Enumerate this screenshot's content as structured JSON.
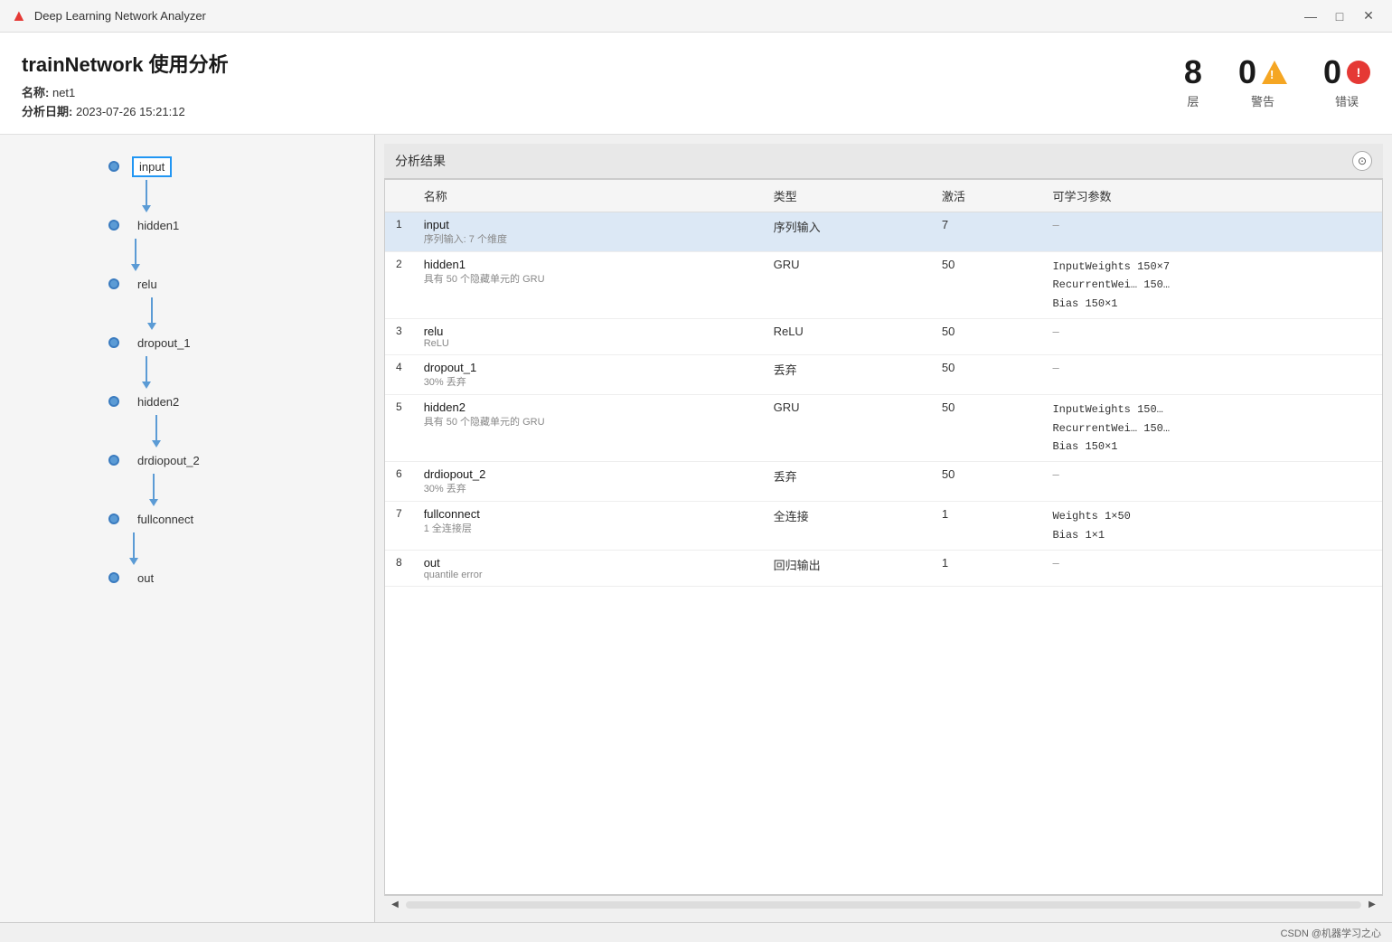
{
  "titlebar": {
    "icon": "🔺",
    "title": "Deep Learning Network Analyzer",
    "minimize": "—",
    "maximize": "□",
    "close": "✕"
  },
  "header": {
    "main_title": "trainNetwork 使用分析",
    "name_label": "名称:",
    "name_value": "net1",
    "date_label": "分析日期:",
    "date_value": "2023-07-26 15:21:12",
    "stats": {
      "layers": {
        "value": "8",
        "label": "层"
      },
      "warnings": {
        "value": "0",
        "label": "警告"
      },
      "errors": {
        "value": "0",
        "label": "错误"
      }
    }
  },
  "network": {
    "nodes": [
      {
        "id": "input",
        "label": "input",
        "selected": true
      },
      {
        "id": "hidden1",
        "label": "hidden1",
        "selected": false
      },
      {
        "id": "relu",
        "label": "relu",
        "selected": false
      },
      {
        "id": "dropout_1",
        "label": "dropout_1",
        "selected": false
      },
      {
        "id": "hidden2",
        "label": "hidden2",
        "selected": false
      },
      {
        "id": "drdiopout_2",
        "label": "drdiopout_2",
        "selected": false
      },
      {
        "id": "fullconnect",
        "label": "fullconnect",
        "selected": false
      },
      {
        "id": "out",
        "label": "out",
        "selected": false
      }
    ]
  },
  "results": {
    "panel_title": "分析结果",
    "columns": {
      "name": "名称",
      "type": "类型",
      "activation": "激活",
      "learnable": "可学习参数"
    },
    "rows": [
      {
        "num": "1",
        "name": "input",
        "sub": "序列输入: 7 个维度",
        "type": "序列输入",
        "activation": "7",
        "learnable": "–",
        "selected": true
      },
      {
        "num": "2",
        "name": "hidden1",
        "sub": "具有 50 个隐藏单元的 GRU",
        "type": "GRU",
        "activation": "50",
        "learnable": "InputWeights  150×7\nRecurrentWei… 150…\nBias          150×1",
        "selected": false
      },
      {
        "num": "3",
        "name": "relu",
        "sub": "ReLU",
        "type": "ReLU",
        "activation": "50",
        "learnable": "–",
        "selected": false
      },
      {
        "num": "4",
        "name": "dropout_1",
        "sub": "30% 丢弃",
        "type": "丢弃",
        "activation": "50",
        "learnable": "–",
        "selected": false
      },
      {
        "num": "5",
        "name": "hidden2",
        "sub": "具有 50 个隐藏单元的 GRU",
        "type": "GRU",
        "activation": "50",
        "learnable": "InputWeights  150…\nRecurrentWei… 150…\nBias          150×1",
        "selected": false
      },
      {
        "num": "6",
        "name": "drdiopout_2",
        "sub": "30% 丢弃",
        "type": "丢弃",
        "activation": "50",
        "learnable": "–",
        "selected": false
      },
      {
        "num": "7",
        "name": "fullconnect",
        "sub": "1 全连接层",
        "type": "全连接",
        "activation": "1",
        "learnable": "Weights  1×50\nBias     1×1",
        "selected": false
      },
      {
        "num": "8",
        "name": "out",
        "sub": "quantile error",
        "type": "回归输出",
        "activation": "1",
        "learnable": "–",
        "selected": false
      }
    ]
  },
  "footer": {
    "text": "CSDN @机器学习之心"
  }
}
